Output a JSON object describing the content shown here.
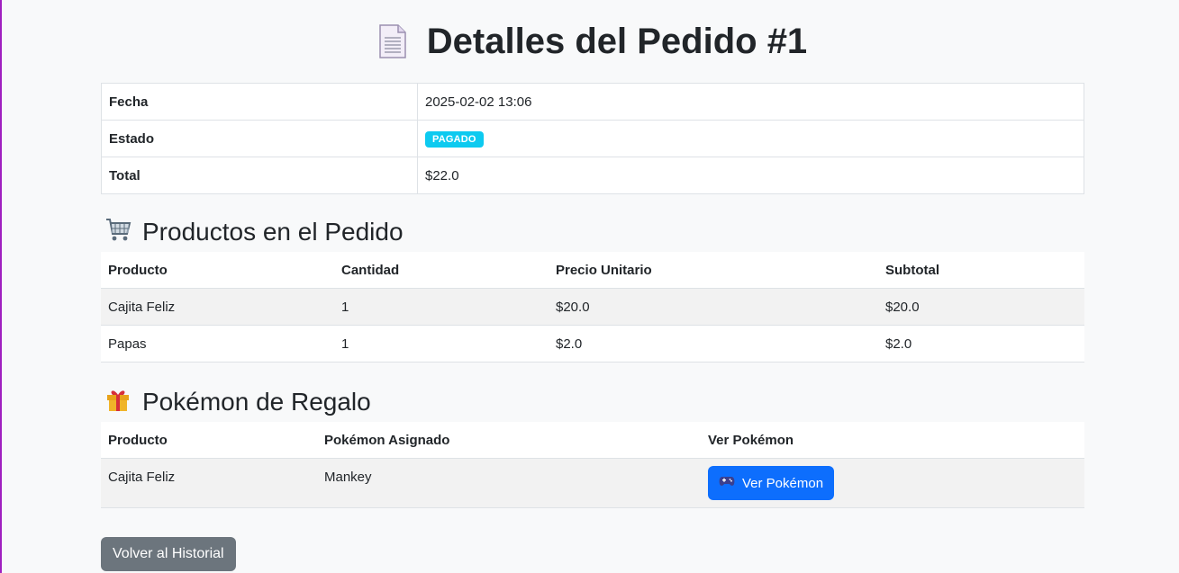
{
  "page": {
    "title": "Detalles del Pedido #1",
    "title_icon": "document-icon"
  },
  "order_info": [
    {
      "label": "Fecha",
      "value": "2025-02-02 13:06"
    },
    {
      "label": "Estado",
      "value": "PAGADO",
      "badge_color": "#0dcaf0"
    },
    {
      "label": "Total",
      "value": "$22.0"
    }
  ],
  "products": {
    "heading": "Productos en el Pedido",
    "heading_icon": "shopping-cart-icon",
    "columns": [
      "Producto",
      "Cantidad",
      "Precio Unitario",
      "Subtotal"
    ],
    "rows": [
      [
        "Cajita Feliz",
        "1",
        "$20.0",
        "$20.0"
      ],
      [
        "Papas",
        "1",
        "$2.0",
        "$2.0"
      ]
    ]
  },
  "gifts": {
    "heading": "Pokémon de Regalo",
    "heading_icon": "gift-icon",
    "columns": [
      "Producto",
      "Pokémon Asignado",
      "Ver Pokémon"
    ],
    "rows": [
      {
        "product": "Cajita Feliz",
        "pokemon": "Mankey",
        "button": "Ver Pokémon",
        "button_icon": "gamepad-icon"
      }
    ]
  },
  "back_button": "Volver al Historial",
  "colors": {
    "primary": "#0d6efd",
    "secondary": "#6c757d",
    "info": "#0dcaf0"
  }
}
